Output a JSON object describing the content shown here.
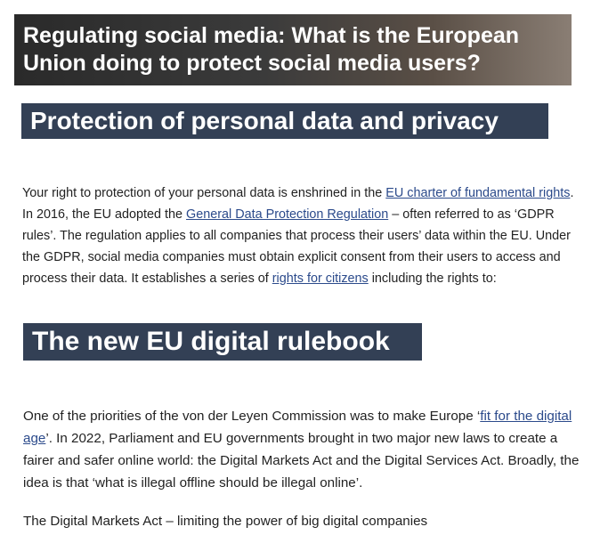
{
  "hero": {
    "title": "Regulating social media: What is the European Union doing to protect social media users?"
  },
  "section1": {
    "heading": "Protection of personal data and privacy",
    "p1_a": "Your right to protection of your personal data is enshrined in the ",
    "link_charter": "EU charter of fundamental rights",
    "p1_b": ". In 2016, the EU adopted the ",
    "link_gdpr": "General Data Protection Regulation",
    "p1_c": " – often referred to as ‘GDPR rules’. The regulation applies to all companies that process their users’ data within the EU. Under the GDPR, social media companies must obtain explicit consent from their users to access and process their data. It establishes a series of ",
    "link_rights": "rights for citizens",
    "p1_d": " including the rights to:"
  },
  "section2": {
    "heading": "The new EU digital rulebook",
    "p2_a": "One of the priorities of the von der Leyen Commission was to make Europe ‘",
    "link_digital_age": "fit for the digital age",
    "p2_b": "’. In 2022, Parliament and EU governments brought in two major new laws to create a fairer and safer online world: the Digital Markets Act and the Digital Services Act. Broadly, the idea is that ‘what is illegal offline should be illegal online’.",
    "p3": "The Digital Markets Act – limiting the power of big digital companies"
  }
}
